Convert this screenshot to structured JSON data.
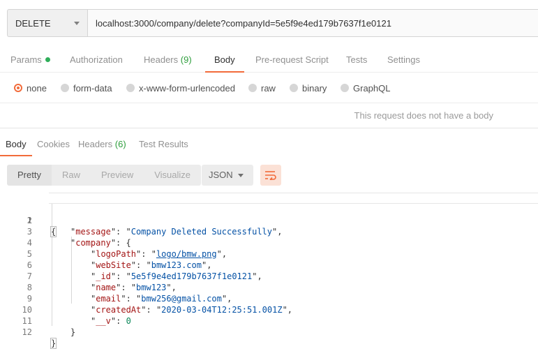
{
  "request": {
    "method": "DELETE",
    "url": "localhost:3000/company/delete?companyId=5e5f9e4ed179b7637f1e0121"
  },
  "request_tabs": [
    {
      "label": "Params",
      "count": "",
      "dot": true
    },
    {
      "label": "Authorization",
      "count": ""
    },
    {
      "label": "Headers",
      "count": "(9)"
    },
    {
      "label": "Body",
      "count": "",
      "active": true
    },
    {
      "label": "Pre-request Script",
      "count": ""
    },
    {
      "label": "Tests",
      "count": ""
    },
    {
      "label": "Settings",
      "count": ""
    }
  ],
  "body_types": [
    "none",
    "form-data",
    "x-www-form-urlencoded",
    "raw",
    "binary",
    "GraphQL"
  ],
  "body_type_selected": "none",
  "no_body_message": "This request does not have a body",
  "response_tabs": [
    {
      "label": "Body",
      "count": "",
      "active": true
    },
    {
      "label": "Cookies",
      "count": ""
    },
    {
      "label": "Headers",
      "count": "(6)"
    },
    {
      "label": "Test Results",
      "count": ""
    }
  ],
  "view_modes": [
    "Pretty",
    "Raw",
    "Preview",
    "Visualize"
  ],
  "format": "JSON",
  "accent_color": "#f26b3a",
  "count_color": "#2e9e3c",
  "response_lines": [
    {
      "n": "1",
      "text": "{"
    },
    {
      "n": "2",
      "key": "message",
      "value": "Company Deleted Successfully",
      "after": ","
    },
    {
      "n": "3",
      "key": "company",
      "after": ": {"
    },
    {
      "n": "4",
      "key": "logoPath",
      "value": "logo/bmw.png",
      "after": ","
    },
    {
      "n": "5",
      "key": "webSite",
      "value": "bmw123.com",
      "after": ","
    },
    {
      "n": "6",
      "key": "_id",
      "value": "5e5f9e4ed179b7637f1e0121",
      "after": ","
    },
    {
      "n": "7",
      "key": "name",
      "value": "bmw123",
      "after": ","
    },
    {
      "n": "8",
      "key": "email",
      "value": "bmw256@gmail.com",
      "after": ","
    },
    {
      "n": "9",
      "key": "createdAt",
      "value": "2020-03-04T12:25:51.001Z",
      "after": ","
    },
    {
      "n": "10",
      "key": "__v",
      "number": "0"
    },
    {
      "n": "11",
      "text": "}"
    },
    {
      "n": "12",
      "text": "}"
    }
  ]
}
